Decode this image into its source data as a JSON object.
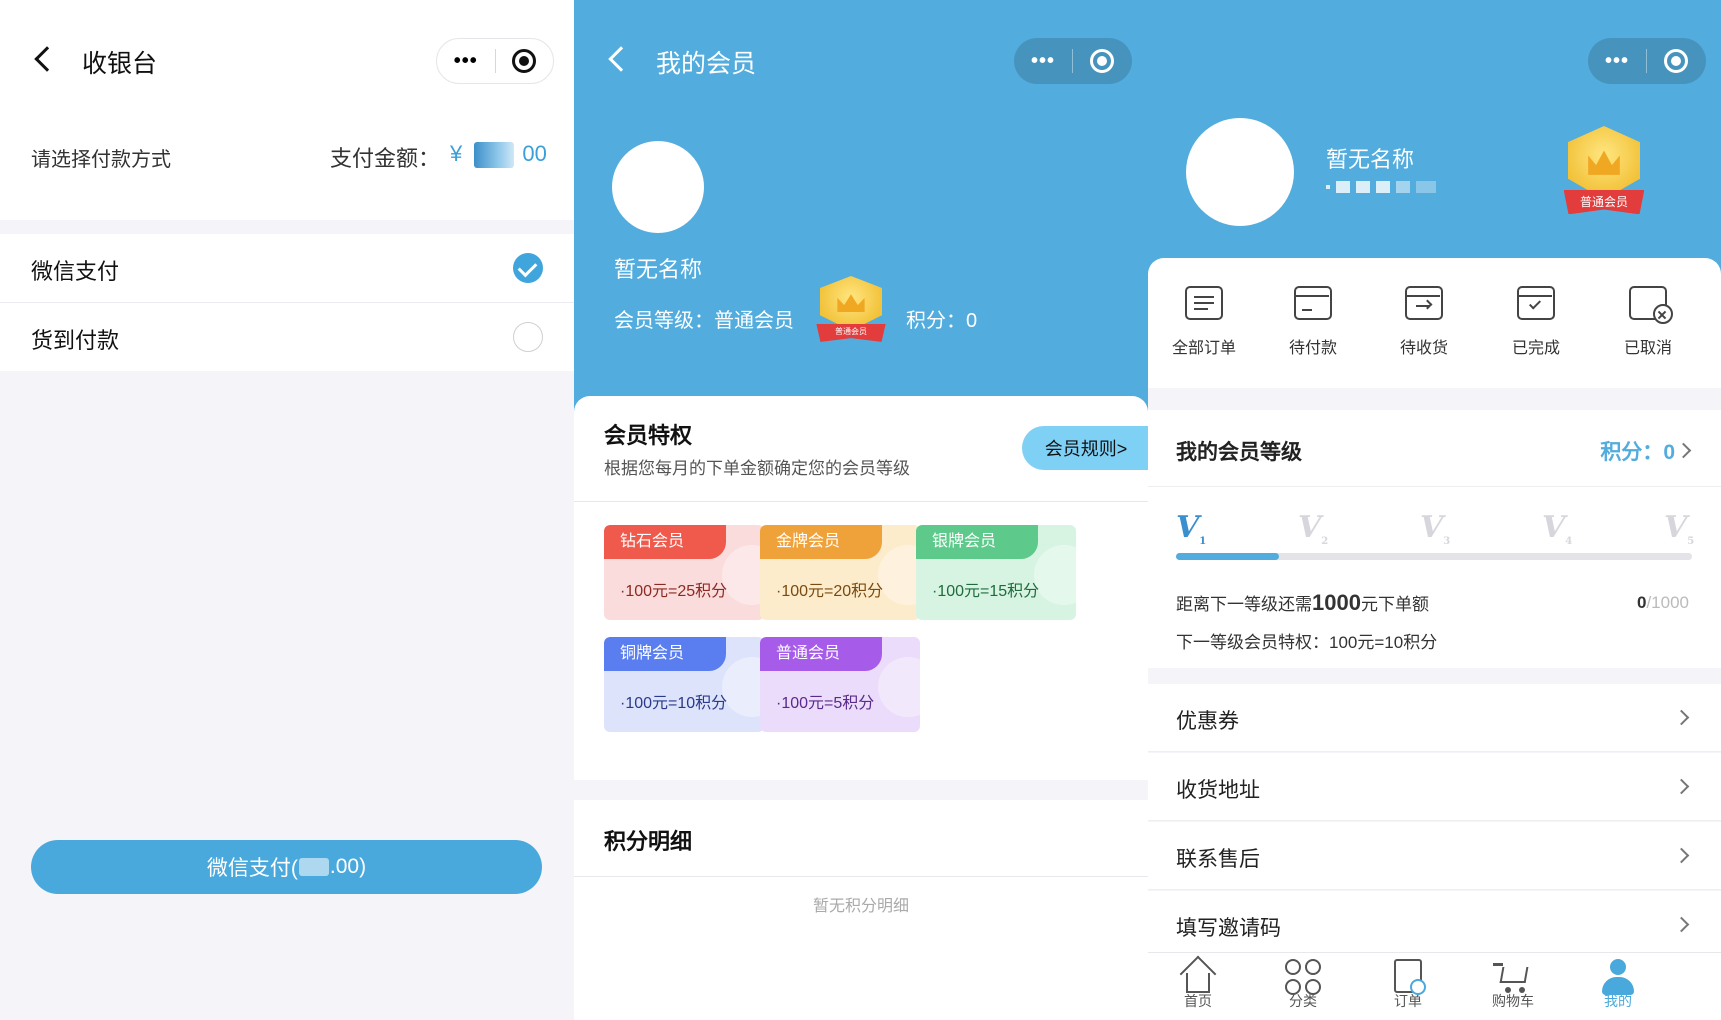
{
  "checkout": {
    "title": "收银台",
    "choose_method": "请选择付款方式",
    "amount_label": "支付金额：",
    "amount_currency": "¥",
    "amount_suffix": "00",
    "options": [
      {
        "label": "微信支付",
        "selected": true
      },
      {
        "label": "货到付款",
        "selected": false
      }
    ],
    "pay_button_prefix": "微信支付(",
    "pay_button_suffix": ".00)"
  },
  "membership": {
    "title": "我的会员",
    "name": "暂无名称",
    "level_text": "会员等级：普通会员",
    "points_text": "积分：0",
    "badge_label": "普通会员",
    "privileges_title": "会员特权",
    "privileges_sub": "根据您每月的下单金额确定您的会员等级",
    "rules_button": "会员规则>",
    "tiers": [
      {
        "name": "钻石会员",
        "rate": "·100元=25积分",
        "tag_color": "#ef5a4c",
        "bg": "#fbdcdc",
        "text_color": "#8a2a22"
      },
      {
        "name": "金牌会员",
        "rate": "·100元=20积分",
        "tag_color": "#f0a23a",
        "bg": "#fdeccc",
        "text_color": "#7a4a10"
      },
      {
        "name": "银牌会员",
        "rate": "·100元=15积分",
        "tag_color": "#5dc98a",
        "bg": "#d7f4e2",
        "text_color": "#1f6b3e"
      },
      {
        "name": "铜牌会员",
        "rate": "·100元=10积分",
        "tag_color": "#5a7ef0",
        "bg": "#dde3fb",
        "text_color": "#2a3a8a"
      },
      {
        "name": "普通会员",
        "rate": "·100元=5积分",
        "tag_color": "#a65ce8",
        "bg": "#ecdcfb",
        "text_color": "#5a2a8a"
      }
    ],
    "points_detail_title": "积分明细",
    "points_empty": "暂无积分明细"
  },
  "profile": {
    "name": "暂无名称",
    "badge_label": "普通会员",
    "orders": [
      {
        "label": "全部订单",
        "icon": "list-doc-icon"
      },
      {
        "label": "待付款",
        "icon": "wallet-icon"
      },
      {
        "label": "待收货",
        "icon": "box-arrow-icon"
      },
      {
        "label": "已完成",
        "icon": "box-check-icon"
      },
      {
        "label": "已取消",
        "icon": "doc-cancel-icon"
      }
    ],
    "level_title": "我的会员等级",
    "points_label": "积分：",
    "points_value": "0",
    "levels": [
      "V",
      "V",
      "V",
      "V",
      "V"
    ],
    "level_subs": [
      "1",
      "2",
      "3",
      "4",
      "5"
    ],
    "progress_fraction": 0.2,
    "need_prefix": "距离下一等级还需",
    "need_amount": "1000",
    "need_suffix": "元下单额",
    "need_current": "0",
    "need_total": "/1000",
    "next_privilege": "下一等级会员特权：100元=10积分",
    "menu": [
      "优惠券",
      "收货地址",
      "联系售后",
      "填写邀请码"
    ],
    "tabs": [
      {
        "label": "首页",
        "icon": "home-icon",
        "active": false
      },
      {
        "label": "分类",
        "icon": "category-icon",
        "active": false
      },
      {
        "label": "订单",
        "icon": "order-icon",
        "active": false
      },
      {
        "label": "购物车",
        "icon": "cart-icon",
        "active": false
      },
      {
        "label": "我的",
        "icon": "user-icon",
        "active": true
      }
    ]
  },
  "colors": {
    "accent": "#52acdd",
    "check": "#3fa5dc"
  }
}
